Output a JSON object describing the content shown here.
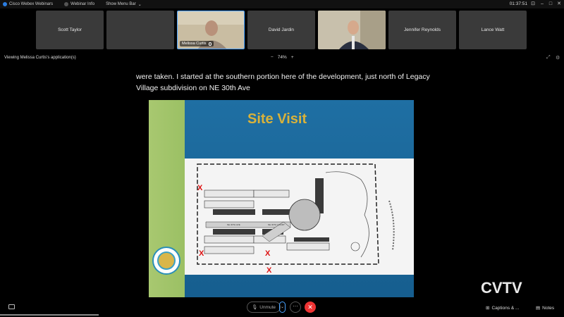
{
  "topbar": {
    "app_name": "Cisco Webex Webinars",
    "webinar_info": "Webinar Info",
    "show_menu_bar": "Show Menu Bar",
    "time": "01:37:51"
  },
  "participants": [
    {
      "name": "Scott Taylor",
      "video": false
    },
    {
      "name": "",
      "video": false
    },
    {
      "name": "Melissa Curtis",
      "video": true,
      "active": true
    },
    {
      "name": "David Jardin",
      "video": false
    },
    {
      "name": "",
      "video": true
    },
    {
      "name": "Jennifer Reynolds",
      "video": false
    },
    {
      "name": "Lance Watt",
      "video": false
    }
  ],
  "viewbar": {
    "viewing_label": "Viewing Melissa Curtis's application(s)",
    "zoom_minus": "−",
    "zoom_level": "74%",
    "zoom_plus": "+"
  },
  "caption": {
    "text": "were taken. I started at the southern portion here of the development, just north of Legacy Village subdivision on NE 30th Ave"
  },
  "slide": {
    "title": "Site Visit",
    "title_color": "#d9b23a",
    "background_color": "#1f6fa3",
    "sidebar_color": "#a8c870",
    "map_markers": [
      {
        "symbol": "X"
      },
      {
        "symbol": "X"
      },
      {
        "symbol": "X"
      },
      {
        "symbol": "X"
      }
    ],
    "map_street_labels": [
      "NE 30TH AVE",
      "NE 30TH COURT"
    ]
  },
  "bottombar": {
    "unmute_label": "Unmute",
    "more_label": "···",
    "leave_label": "✕",
    "captions_label": "Captions & ...",
    "notes_label": "Notes",
    "watermark": "CVTV"
  },
  "colors": {
    "accent": "#4aa3ff",
    "leave_red": "#e33333"
  }
}
